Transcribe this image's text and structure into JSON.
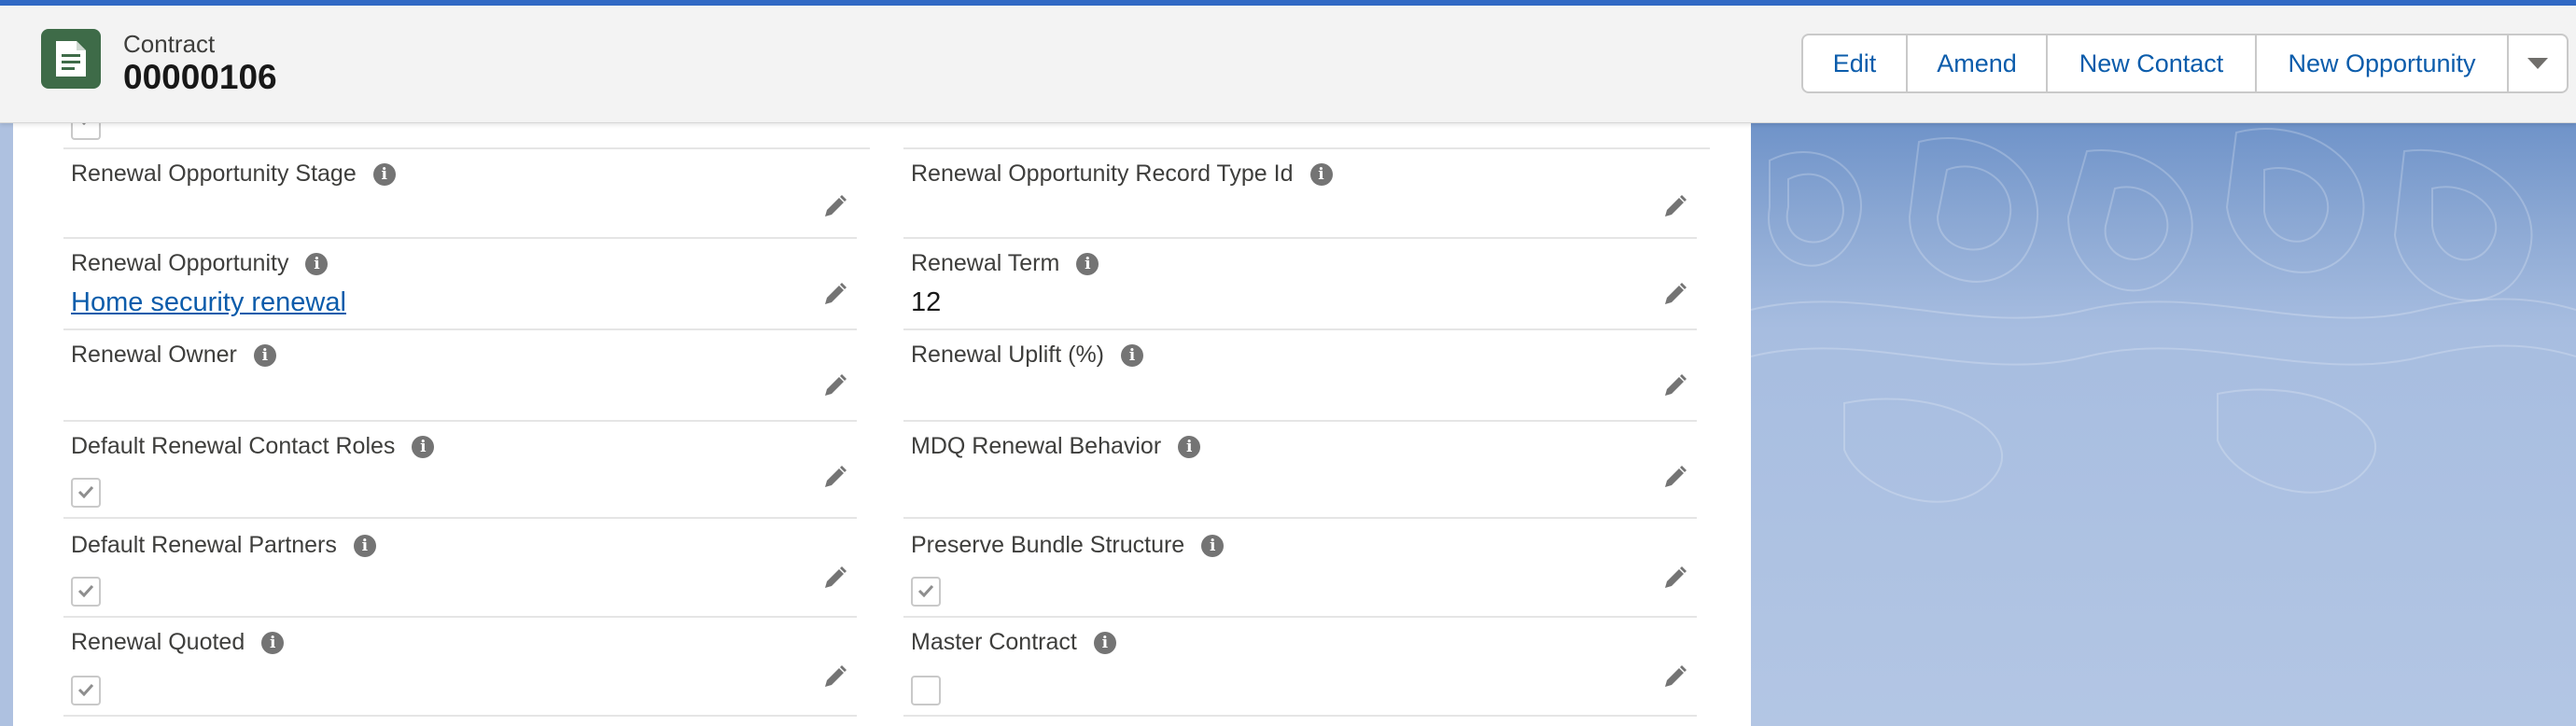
{
  "colors": {
    "brand_blue": "#0b5cab",
    "record_icon_bg": "#3e6b48",
    "top_accent": "#3069c4"
  },
  "header": {
    "object_label": "Contract",
    "record_name": "00000106",
    "record_icon": "contract-document-icon",
    "actions": [
      "Edit",
      "Amend",
      "New Contact",
      "New Opportunity"
    ],
    "overflow_icon": "chevron-down-icon"
  },
  "fields": {
    "left": [
      {
        "label": "Renewal Opportunity Stage",
        "value": ""
      },
      {
        "label": "Renewal Opportunity",
        "value": "Home security renewal"
      },
      {
        "label": "Renewal Owner",
        "value": ""
      },
      {
        "label": "Default Renewal Contact Roles",
        "checked": true
      },
      {
        "label": "Default Renewal Partners",
        "checked": true
      },
      {
        "label": "Renewal Quoted",
        "checked": true
      }
    ],
    "right": [
      {
        "label": "Renewal Opportunity Record Type Id",
        "value": ""
      },
      {
        "label": "Renewal Term",
        "value": "12"
      },
      {
        "label": "Renewal Uplift (%)",
        "value": ""
      },
      {
        "label": "MDQ Renewal Behavior",
        "value": ""
      },
      {
        "label": "Preserve Bundle Structure",
        "checked": true
      },
      {
        "label": "Master Contract",
        "checked": false
      }
    ]
  },
  "icons": {
    "info": "info-icon",
    "edit": "pencil-edit-icon",
    "check": "checkmark-icon"
  }
}
